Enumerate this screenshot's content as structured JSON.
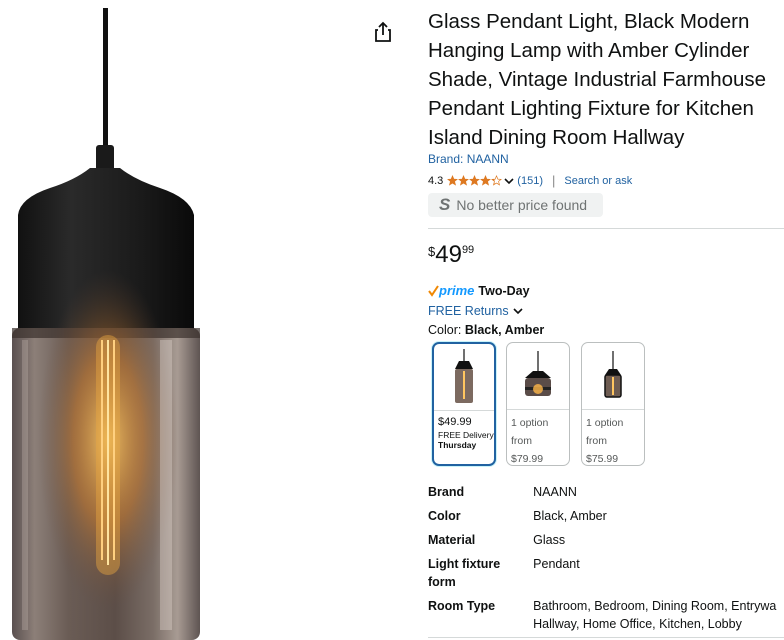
{
  "product": {
    "title_lines": [
      "Glass Pendant Light, Black Modern",
      "Hanging Lamp with Amber Cylinder",
      "Shade, Vintage Industrial Farmhouse",
      "Pendant Lighting Fixture for Kitchen",
      "Island Dining Room Hallway"
    ],
    "brand_link": "Brand: NAANN",
    "rating": "4.3",
    "rating_value": 4.3,
    "rating_count": "(151)",
    "search_or_ask": "Search or ask",
    "price_badge": "No better price found",
    "price": {
      "symbol": "$",
      "whole": "49",
      "fraction": "99"
    },
    "prime_label": "prime",
    "delivery": "Two-Day",
    "returns": "FREE Returns",
    "color_label": "Color:",
    "color_value": "Black, Amber"
  },
  "swatches": [
    {
      "price": "$49.99",
      "line1": "FREE Delivery",
      "line2": "Thursday",
      "selected": true
    },
    {
      "line1": "1 option",
      "line2": "from",
      "price": "$79.99",
      "selected": false
    },
    {
      "line1": "1 option",
      "line2": "from",
      "price": "$75.99",
      "selected": false
    }
  ],
  "specs": [
    {
      "key": "Brand",
      "value": "NAANN"
    },
    {
      "key": "Color",
      "value": "Black, Amber"
    },
    {
      "key": "Material",
      "value": "Glass"
    },
    {
      "key_lines": [
        "Light fixture",
        "form"
      ],
      "value": "Pendant"
    },
    {
      "key": "Room Type",
      "value_lines": [
        "Bathroom, Bedroom, Dining Room, Entrywa",
        "Hallway, Home Office, Kitchen, Lobby"
      ]
    }
  ],
  "icons": {
    "share": "share-icon",
    "star": "star-icon",
    "chevron": "chevron-down-icon",
    "seller": "s-logo-icon"
  },
  "colors": {
    "link": "#2162a1",
    "star": "#de7921",
    "prime": "#1399ff",
    "prime_check": "#f08804",
    "selected_border": "#2162a1"
  }
}
